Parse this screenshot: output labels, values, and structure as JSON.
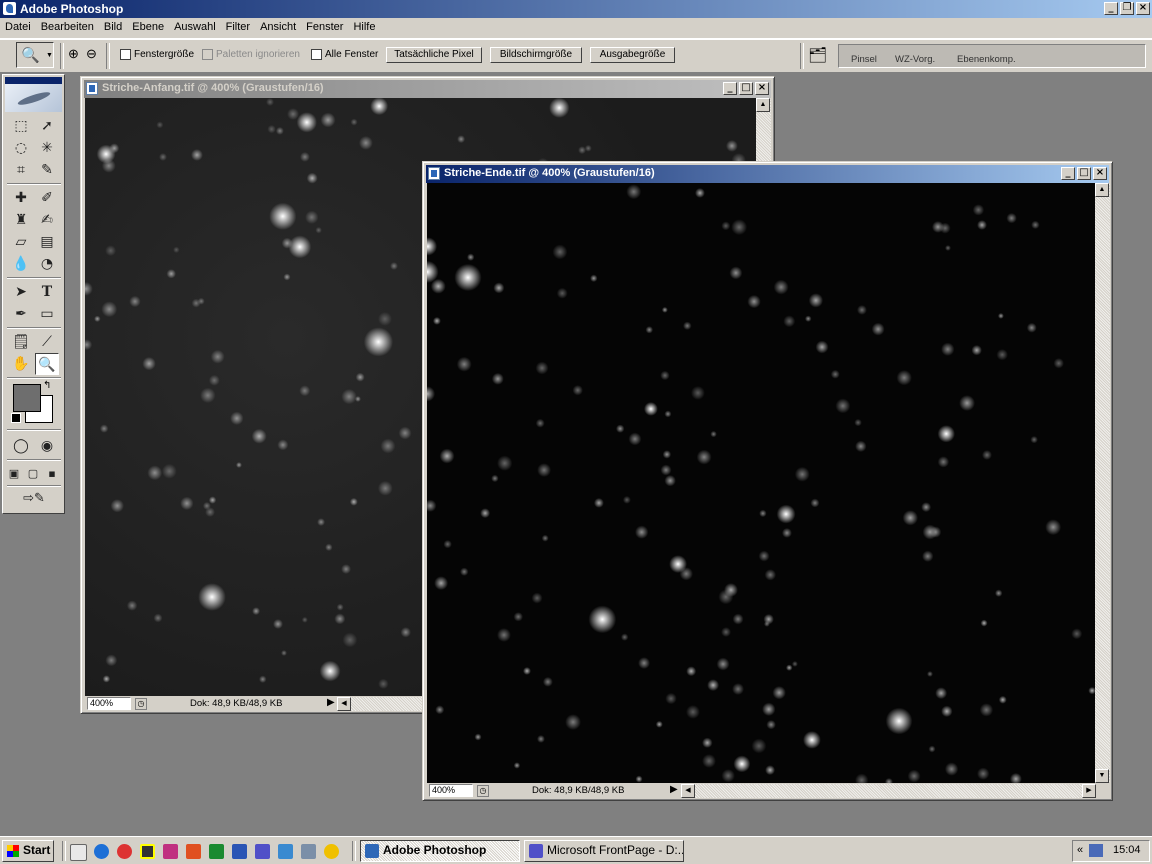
{
  "app": {
    "title": "Adobe Photoshop"
  },
  "menu": [
    "Datei",
    "Bearbeiten",
    "Bild",
    "Ebene",
    "Auswahl",
    "Filter",
    "Ansicht",
    "Fenster",
    "Hilfe"
  ],
  "options": {
    "fenstergroesse": "Fenstergröße",
    "paletten_ignorieren": "Paletten ignorieren",
    "alle_fenster": "Alle Fenster",
    "tatsaechliche_pixel": "Tatsächliche Pixel",
    "bildschirmgroesse": "Bildschirmgröße",
    "ausgabegroesse": "Ausgabegröße"
  },
  "palette_well": [
    "Pinsel",
    "WZ-Vorg.",
    "Ebenenkomp."
  ],
  "doc1": {
    "title": "Striche-Anfang.tif @ 400% (Graustufen/16)",
    "zoom": "400%",
    "doc_info": "Dok: 48,9 KB/48,9 KB"
  },
  "doc2": {
    "title": "Striche-Ende.tif @ 400% (Graustufen/16)",
    "zoom": "400%",
    "doc_info": "Dok: 48,9 KB/48,9 KB"
  },
  "taskbar": {
    "start": "Start",
    "tasks": [
      "Adobe Photoshop",
      "Microsoft FrontPage - D:..."
    ],
    "tray_arrows": "«",
    "clock": "15:04"
  },
  "colors": {
    "titlebar_active_start": "#0a246a",
    "titlebar_active_end": "#a6caf0",
    "window_face": "#d4d0c8",
    "desktop": "#808080",
    "foreground_color": "#6e6e6e",
    "background_color": "#ffffff"
  },
  "icons": {
    "toolbox": [
      "marquee-icon",
      "move-icon",
      "lasso-icon",
      "magic-wand-icon",
      "crop-icon",
      "slice-icon",
      "healing-brush-icon",
      "brush-icon",
      "clone-stamp-icon",
      "history-brush-icon",
      "eraser-icon",
      "gradient-icon",
      "blur-icon",
      "dodge-icon",
      "path-selection-icon",
      "type-icon",
      "pen-icon",
      "shape-icon",
      "notes-icon",
      "eyedropper-icon",
      "hand-icon",
      "zoom-icon"
    ]
  }
}
